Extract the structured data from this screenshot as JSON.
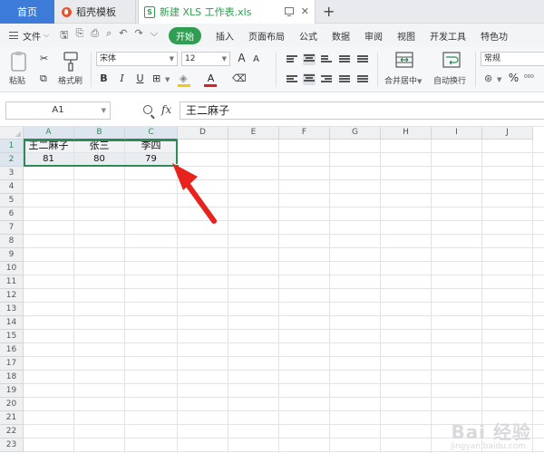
{
  "tabs": {
    "home": "首页",
    "docer": "稻壳模板",
    "file": "新建 XLS 工作表.xls",
    "new_tab": "+"
  },
  "menu": {
    "file": "文件",
    "start": "开始",
    "items": [
      "插入",
      "页面布局",
      "公式",
      "数据",
      "审阅",
      "视图",
      "开发工具",
      "特色功"
    ]
  },
  "ribbon": {
    "paste": "粘贴",
    "format_painter": "格式刷",
    "font_name": "宋体",
    "font_size": "12",
    "merge_center": "合并居中",
    "wrap_text": "自动换行",
    "number_format": "常规",
    "bold": "B",
    "italic": "I",
    "underline": "U",
    "percent": "%",
    "font_color_glyph": "A",
    "font_grow": "A",
    "font_shrink": "A"
  },
  "formula_bar": {
    "cell_ref": "A1",
    "fx": "fx",
    "value": "王二麻子"
  },
  "sheet": {
    "columns": [
      "A",
      "B",
      "C",
      "D",
      "E",
      "F",
      "G",
      "H",
      "I",
      "J"
    ],
    "rows": [
      "1",
      "2",
      "3",
      "4",
      "5",
      "6",
      "7",
      "8",
      "9",
      "10",
      "11",
      "12",
      "13",
      "14",
      "15",
      "16",
      "17",
      "18",
      "19",
      "20",
      "21",
      "22",
      "23"
    ],
    "data": [
      [
        "王二麻子",
        "张三",
        "李四"
      ],
      [
        "81",
        "80",
        "79"
      ]
    ]
  },
  "watermark": {
    "main": "Bai 经验",
    "sub": "jingyan.baidu.com"
  },
  "colors": {
    "accent": "#2e8b57",
    "start_button": "#2f9e53",
    "home_tab": "#3d7bd9",
    "arrow": "#e8231e"
  }
}
